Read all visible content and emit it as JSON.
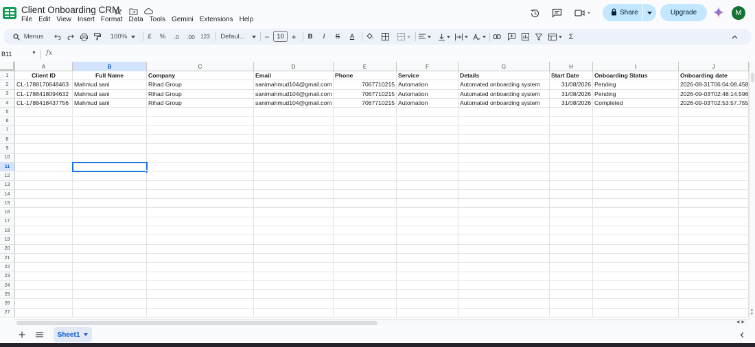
{
  "doc": {
    "title": "Client Onboarding CRM",
    "menus": [
      "File",
      "Edit",
      "View",
      "Insert",
      "Format",
      "Data",
      "Tools",
      "Gemini",
      "Extensions",
      "Help"
    ]
  },
  "actions": {
    "share_label": "Share",
    "upgrade_label": "Upgrade",
    "avatar_initial": "M"
  },
  "toolbar": {
    "menus_label": "Menus",
    "zoom": "100%",
    "currency": "£",
    "percent": "%",
    "dec_decrease": ".0",
    "dec_increase": ".00",
    "number_format": "123",
    "font": "Defaul...",
    "font_size": "10",
    "minus": "−",
    "plus": "+",
    "bold": "B",
    "italic": "I",
    "strike": "S",
    "text_color": "A",
    "function_symbol": "Σ"
  },
  "formula": {
    "name_box": "B11",
    "fx": "fx"
  },
  "grid": {
    "columns": [
      "A",
      "B",
      "C",
      "D",
      "E",
      "F",
      "G",
      "H",
      "I",
      "J"
    ],
    "selected_column": "B",
    "selected_row": "11",
    "row_numbers": [
      "1",
      "2",
      "3",
      "4",
      "5",
      "6",
      "7",
      "8",
      "9",
      "10",
      "11",
      "12",
      "13",
      "14",
      "15",
      "16",
      "17",
      "18",
      "19",
      "20",
      "21",
      "22",
      "23",
      "24",
      "25",
      "26",
      "27"
    ],
    "headers": [
      "Client ID",
      "Full Name",
      "Company",
      "Email",
      "Phone",
      "Service",
      "Details",
      "Start Date",
      "Onboarding Status",
      "Onboarding date"
    ],
    "rows": [
      [
        "CL-1788170648463",
        "Mahmud sani",
        "Rihad Group",
        "sanimahmud104@gmail.com",
        "7067710215",
        "Automation",
        "Automated onboarding system",
        "31/08/2026",
        "Pending",
        "2026-08-31T06:04:08.458"
      ],
      [
        "CL-1788418094632",
        "Mahmud sani",
        "Rihad Group",
        "sanimahmud104@gmail.com",
        "7067710215",
        "Automation",
        "Automated onboarding system",
        "31/08/2026",
        "Pending",
        "2026-09-03T02:48:14.596"
      ],
      [
        "CL-1788418437756",
        "Mahmud sani",
        "Rihad Group",
        "sanimahmud104@gmail.com",
        "7067710215",
        "Automation",
        "Automated onboarding system",
        "31/08/2026",
        "Completed",
        "2026-09-03T02:53:57.755"
      ]
    ]
  },
  "sheets": {
    "active_tab": "Sheet1"
  },
  "colors": {
    "accent": "#1a73e8",
    "share_bg": "#c2e7ff",
    "selected_header": "#d3e3fd",
    "logo_green": "#0f9d58"
  }
}
